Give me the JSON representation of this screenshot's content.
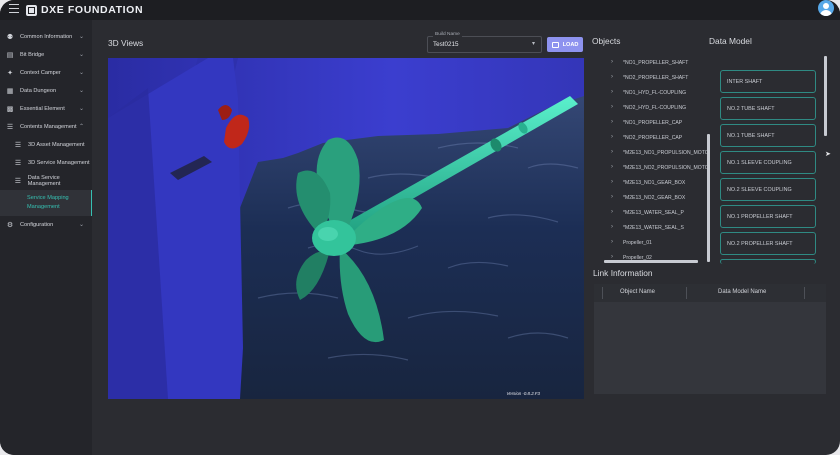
{
  "app": {
    "brand": "DXE FOUNDATION"
  },
  "sidebar": {
    "items": [
      {
        "label": "Common Information",
        "icon": "people-icon",
        "expanded": false
      },
      {
        "label": "Bit Bridge",
        "icon": "document-icon",
        "expanded": false
      },
      {
        "label": "Context Camper",
        "icon": "network-icon",
        "expanded": false
      },
      {
        "label": "Data Dungeon",
        "icon": "database-icon",
        "expanded": false
      },
      {
        "label": "Essential Element",
        "icon": "grid-icon",
        "expanded": false
      },
      {
        "label": "Contents Management",
        "icon": "list-icon",
        "expanded": true
      },
      {
        "label": "3D Asset Management",
        "icon": "list-icon",
        "sub": true
      },
      {
        "label": "3D Service Management",
        "icon": "list-icon",
        "sub": true
      },
      {
        "label": "Data Service Management",
        "icon": "list-icon",
        "sub": true
      },
      {
        "label": "Service Mapping Management",
        "icon": "list-icon",
        "sub": true,
        "active": true
      },
      {
        "label": "Configuration",
        "icon": "gear-icon",
        "expanded": false
      }
    ]
  },
  "views": {
    "title": "3D Views",
    "build_label": "Build Name",
    "build_value": "Test0215",
    "load_label": "LOAD",
    "version": "Version -0.8.2.F3"
  },
  "objects": {
    "title": "Objects",
    "items": [
      "*NO1_PROPELLER_SHAFT",
      "*NO2_PROPELLER_SHAFT",
      "*NO1_HYD_FL-COUPLING",
      "*NO2_HYD_FL-COUPLING",
      "*NO1_PROPELLER_CAP",
      "*NO2_PROPELLER_CAP",
      "*M2E13_NO1_PROPULSION_MOTO",
      "*M2E13_NO2_PROPULSION_MOTO",
      "*M2E13_NO1_GEAR_BOX",
      "*M2E13_NO2_GEAR_BOX",
      "*M2E13_WATER_SEAL_P",
      "*M2E13_WATER_SEAL_S",
      "Propeller_01",
      "Propeller_02"
    ]
  },
  "data_model": {
    "title": "Data Model",
    "items": [
      "INTER SHAFT",
      "NO.2 TUBE SHAFT",
      "NO.1 TUBE SHAFT",
      "NO.1 SLEEVE COUPLING",
      "NO.2 SLEEVE COUPLING",
      "NO.1 PROPELLER SHAFT",
      "NO.2 PROPELLER SHAFT"
    ]
  },
  "link_info": {
    "title": "Link Information",
    "col_object": "Object Name",
    "col_model": "Data Model Name"
  },
  "colors": {
    "accent": "#36c0b2",
    "load_button": "#8e93ef",
    "hull": "#3a3cc7",
    "propeller": "#2aa783"
  }
}
